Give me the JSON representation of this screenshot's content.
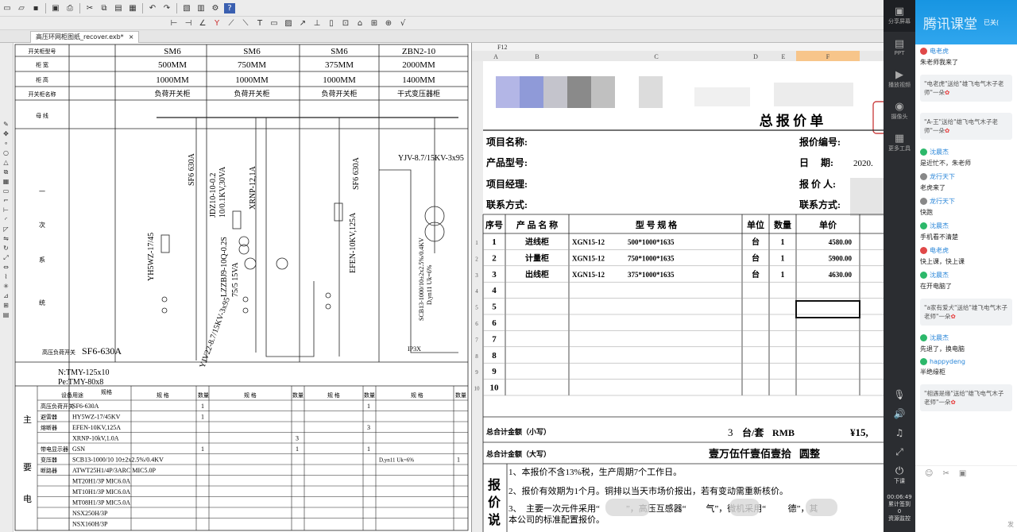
{
  "document_tab": {
    "label": "高压环网柜图纸_recover.exb*",
    "close": "×"
  },
  "toolbar_row1": [
    "new",
    "open",
    "save",
    "print",
    "cut",
    "copy",
    "paste",
    "undo",
    "redo",
    "help"
  ],
  "drawing": {
    "header_rows": [
      {
        "label": "开关柜型号",
        "cells": [
          "SM6",
          "SM6",
          "SM6",
          "ZBN2-10"
        ]
      },
      {
        "label": "柜 宽",
        "cells": [
          "500MM",
          "750MM",
          "375MM",
          "2000MM"
        ]
      },
      {
        "label": "柜 高",
        "cells": [
          "1000MM",
          "1000MM",
          "1000MM",
          "1400MM"
        ]
      },
      {
        "label": "开关柜名称",
        "cells": [
          "负荷开关柜",
          "负荷开关柜",
          "负荷开关柜",
          "干式变压器柜"
        ]
      }
    ],
    "row_label_bus": "母 线",
    "side_label": [
      "一",
      "次",
      "系",
      "统"
    ],
    "vertical_labels": [
      "YH5WZ-17/45",
      "SF6 630A",
      "JDZ10-10-0.2",
      "10/0.1KV,30VA",
      "LZZBJ9-10Q-0.2S",
      "75/5 15VA",
      "XRNP-12,1A",
      "YJV22-8.7/15KV-3x95",
      "EFEN-10KV,125A",
      "SF6 630A",
      "YJV-8.7/15KV-3x95",
      "SCB13-1000/10±2x2.5%/0.4KV",
      "D,yn11 Uk=6%"
    ],
    "ip_label": "IP3X",
    "load_switch": "高压负荷开关",
    "load_switch_model": "SF6-630A",
    "busbar": [
      "N:TMY-125x10",
      "Pe:TMY-80x8"
    ],
    "bom_headers": [
      "设备用途",
      "规格",
      "规 格",
      "数量",
      "规 格",
      "数量",
      "规 格",
      "数量",
      "规 格",
      "数量"
    ],
    "bom_rows": [
      {
        "use": "高压负荷开关",
        "spec": "SF6-630A",
        "q1": "1",
        "q3": "1"
      },
      {
        "use": "避雷器",
        "spec": "HY5WZ-17/45KV",
        "q1": "1",
        "q3": ""
      },
      {
        "use": "熔断器",
        "spec": "EFEN-10KV,125A",
        "q1": "",
        "q3": "3"
      },
      {
        "use": "",
        "spec": "XRNP-10kV,1.0A",
        "q1": "",
        "q2": "3"
      },
      {
        "use": "带电显示器",
        "spec": "GSN",
        "q1": "1",
        "q2": "1",
        "q3": "1"
      },
      {
        "use": "变压器",
        "spec": "SCB13-1000/10 10±2x2.5%/0.4KV",
        "q4": "D,yn11 Uk=6%",
        "q5": "1"
      },
      {
        "use": "断路器",
        "spec": "ATWT25H1/4P/3ARC MIC5.0P"
      },
      {
        "use": "",
        "spec": "MT20H1/3P MIC6.0A"
      },
      {
        "use": "",
        "spec": "MT10H1/3P MIC6.0A"
      },
      {
        "use": "",
        "spec": "MT08H1/3P MIC5.0A"
      },
      {
        "use": "",
        "spec": "NSX250H/3P"
      },
      {
        "use": "",
        "spec": "NSX160H/3P"
      }
    ],
    "bom_side": [
      "主",
      "要",
      "电"
    ]
  },
  "sheet": {
    "cell_ref": "F12",
    "columns": [
      "A",
      "B",
      "C",
      "D",
      "E",
      "F"
    ],
    "title": "总 报 价 单",
    "meta": [
      {
        "label": "项目名称:",
        "right_label": "报价编号:",
        "right_value": ""
      },
      {
        "label": "产品型号:",
        "right_label": "日　 期:",
        "right_value": "2020."
      },
      {
        "label": "项目经理:",
        "right_label": "报 价 人:",
        "right_value": ""
      },
      {
        "label": "联系方式:",
        "right_label": "联系方式:",
        "right_value": ""
      }
    ],
    "table_headers": [
      "序号",
      "产 品 名 称",
      "型 号 规 格",
      "单位",
      "数量",
      "单价"
    ],
    "items": [
      {
        "no": "1",
        "name": "进线柜",
        "model": "XGN15-12",
        "size": "500*1000*1635",
        "unit": "台",
        "qty": "1",
        "price": "4580.00"
      },
      {
        "no": "2",
        "name": "计量柜",
        "model": "XGN15-12",
        "size": "750*1000*1635",
        "unit": "台",
        "qty": "1",
        "price": "5900.00"
      },
      {
        "no": "3",
        "name": "出线柜",
        "model": "XGN15-12",
        "size": "375*1000*1635",
        "unit": "台",
        "qty": "1",
        "price": "4630.00"
      },
      {
        "no": "4"
      },
      {
        "no": "5"
      },
      {
        "no": "6"
      },
      {
        "no": "7"
      },
      {
        "no": "8"
      },
      {
        "no": "9"
      },
      {
        "no": "10"
      }
    ],
    "total_small_label": "总合计金额（小写）",
    "total_qty": "3",
    "total_unit": "台/套",
    "currency": "RMB",
    "total_small_value": "¥15,",
    "total_big_label": "总合计金额（大写）",
    "total_big_value": "壹万伍仟壹佰壹拾",
    "total_big_suffix": "圆整",
    "notes_label": [
      "报",
      "价",
      "说"
    ],
    "notes": [
      "1、本报价不含13%税，生产周期7个工作日。",
      "2、报价有效期为1个月。铜排以当天市场价报出，若有变动需重新核价。",
      "3、　主要一次元件采用“　　　”，高压互感器“　　 气”，微机采用“　 　 德”，其",
      "本公司的标准配置报价。"
    ],
    "row_numbers": [
      "1",
      "2",
      "3",
      "4",
      "5",
      "6",
      "7",
      "8",
      "9",
      "10"
    ]
  },
  "sidebar": {
    "items": [
      {
        "icon": "share-screen-icon",
        "label": "分享屏幕"
      },
      {
        "icon": "ppt-icon",
        "label": "PPT"
      },
      {
        "icon": "video-icon",
        "label": "播放视频"
      },
      {
        "icon": "camera-icon",
        "label": "摄像头"
      },
      {
        "icon": "toolbox-icon",
        "label": "更多工具"
      }
    ],
    "end_class": "下课",
    "timer": "00:06:49",
    "stats_1": "累计签到",
    "stats_2": "0",
    "stats_3": "资源监控"
  },
  "chat": {
    "brand": "腾讯课堂",
    "header_right": "已关(",
    "messages": [
      {
        "type": "msg",
        "user": "电老虎",
        "color": "#e04848",
        "text": "朱老师我来了"
      },
      {
        "type": "gift",
        "text": "\"电老虎\"送给\"雄飞电气木子老师\"一朵"
      },
      {
        "type": "gift",
        "text": "\"A-王\"送给\"雄飞电气木子老师\"一朵"
      },
      {
        "type": "msg",
        "user": "沈晨杰",
        "color": "#2cb86a",
        "text": "是近忙不，朱老师"
      },
      {
        "type": "msg",
        "user": "龙行天下",
        "color": "#888",
        "text": "老虎来了"
      },
      {
        "type": "msg",
        "user": "龙行天下",
        "color": "#888",
        "text": "快跑"
      },
      {
        "type": "msg",
        "user": "沈晨杰",
        "color": "#2cb86a",
        "text": "手机看不清楚"
      },
      {
        "type": "msg",
        "user": "电老虎",
        "color": "#e04848",
        "text": "快上课，快上课"
      },
      {
        "type": "msg",
        "user": "沈晨杰",
        "color": "#2cb86a",
        "text": "在开电脑了"
      },
      {
        "type": "gift",
        "text": "\"a家有爱犬\"送给\"雄飞电气木子老师\"一朵"
      },
      {
        "type": "msg",
        "user": "沈晨杰",
        "color": "#2cb86a",
        "text": "先退了，换电脑"
      },
      {
        "type": "msg",
        "user": "happydeng",
        "color": "#2cb86a",
        "text": "半绝缘柜"
      },
      {
        "type": "gift",
        "text": "\"相遇是缘\"送给\"雄飞电气木子老师\"一朵"
      }
    ],
    "send": "发"
  }
}
